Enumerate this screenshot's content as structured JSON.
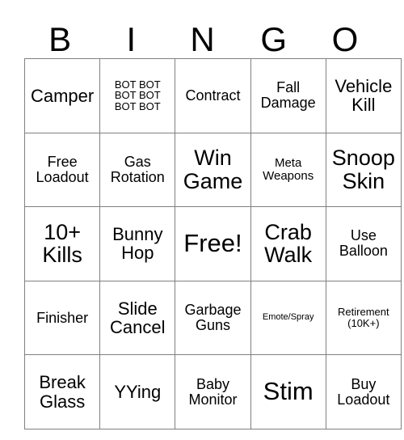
{
  "card": {
    "title": "BINGO",
    "header_letters": [
      "B",
      "I",
      "N",
      "G",
      "O"
    ],
    "grid_size": "5x5",
    "border_color": "#808080",
    "background_color": "#ffffff",
    "text_color": "#000000",
    "free_space": "Free!",
    "rows": [
      [
        {
          "text": "Camper",
          "size": "fs-l"
        },
        {
          "text": "BOT BOT\nBOT BOT\nBOT BOT",
          "size": "fs-xs"
        },
        {
          "text": "Contract",
          "size": "fs-m"
        },
        {
          "text": "Fall\nDamage",
          "size": "fs-m"
        },
        {
          "text": "Vehicle\nKill",
          "size": "fs-l"
        }
      ],
      [
        {
          "text": "Free\nLoadout",
          "size": "fs-m"
        },
        {
          "text": "Gas\nRotation",
          "size": "fs-m"
        },
        {
          "text": "Win\nGame",
          "size": "fs-xl"
        },
        {
          "text": "Meta\nWeapons",
          "size": "fs-s"
        },
        {
          "text": "Snoop\nSkin",
          "size": "fs-xl"
        }
      ],
      [
        {
          "text": "10+\nKills",
          "size": "fs-xl"
        },
        {
          "text": "Bunny\nHop",
          "size": "fs-l"
        },
        {
          "text": "Free!",
          "size": "fs-xxl"
        },
        {
          "text": "Crab\nWalk",
          "size": "fs-xl"
        },
        {
          "text": "Use\nBalloon",
          "size": "fs-m"
        }
      ],
      [
        {
          "text": "Finisher",
          "size": "fs-m"
        },
        {
          "text": "Slide\nCancel",
          "size": "fs-l"
        },
        {
          "text": "Garbage\nGuns",
          "size": "fs-m"
        },
        {
          "text": "Emote/Spray",
          "size": "fs-xxs"
        },
        {
          "text": "Retirement\n(10K+)",
          "size": "fs-xs"
        }
      ],
      [
        {
          "text": "Break\nGlass",
          "size": "fs-l"
        },
        {
          "text": "YYing",
          "size": "fs-l"
        },
        {
          "text": "Baby\nMonitor",
          "size": "fs-m"
        },
        {
          "text": "Stim",
          "size": "fs-xxl"
        },
        {
          "text": "Buy\nLoadout",
          "size": "fs-m"
        }
      ]
    ]
  }
}
